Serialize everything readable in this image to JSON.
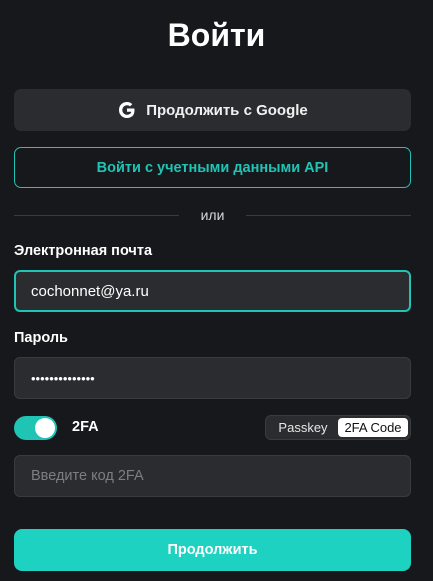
{
  "page": {
    "title": "Войти"
  },
  "google_button": {
    "label": "Продолжить с Google",
    "icon": "google-icon"
  },
  "api_button": {
    "label": "Войти с учетными данными API"
  },
  "divider": {
    "text": "или"
  },
  "email": {
    "label": "Электронная почта",
    "value": "cochonnet@ya.ru"
  },
  "password": {
    "label": "Пароль",
    "value": "••••••••••••••"
  },
  "twofa": {
    "label": "2FA",
    "enabled": true,
    "modes": [
      "Passkey",
      "2FA Code"
    ],
    "selected_mode": "2FA Code",
    "placeholder": "Введите код 2FA"
  },
  "continue_button": {
    "label": "Продолжить"
  },
  "colors": {
    "accent": "#1fc4b5",
    "background": "#17181b",
    "field": "#2b2c30"
  }
}
